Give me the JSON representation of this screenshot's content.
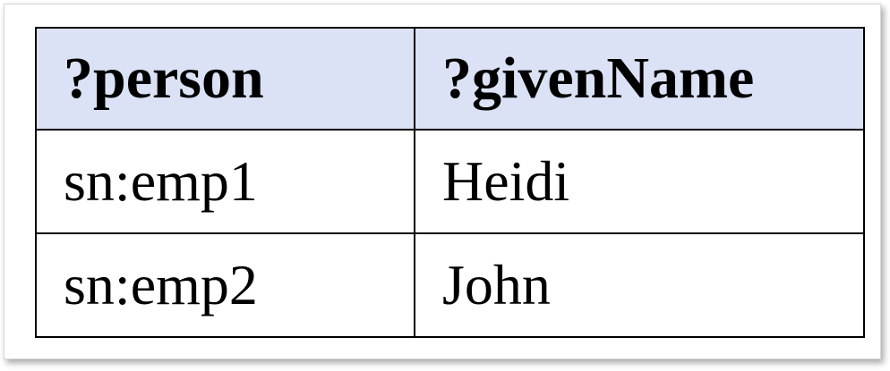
{
  "table": {
    "headers": [
      "?person",
      "?givenName"
    ],
    "rows": [
      [
        "sn:emp1",
        "Heidi"
      ],
      [
        "sn:emp2",
        "John"
      ]
    ]
  },
  "colors": {
    "header_bg": "#dbe2f6",
    "border": "#000000"
  }
}
